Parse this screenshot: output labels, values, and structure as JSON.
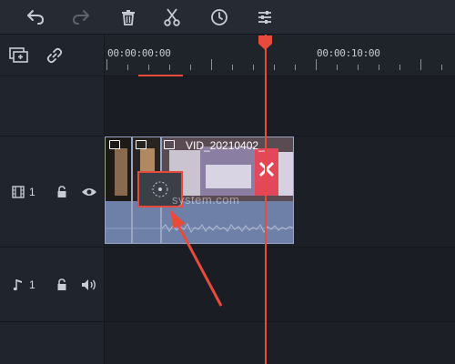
{
  "toolbar": {
    "icons": [
      "undo-icon",
      "redo-icon",
      "delete-icon",
      "cut-icon",
      "speed-clock-icon",
      "adjust-icon"
    ]
  },
  "left_panel": {
    "header_icons": [
      "add-track-icon",
      "link-icon"
    ],
    "video_track": {
      "number": "1",
      "icons": [
        "film-track-icon",
        "lock-icon",
        "eye-icon"
      ]
    },
    "audio_track": {
      "number": "1",
      "icons": [
        "music-note-icon",
        "lock-icon",
        "speaker-icon"
      ]
    }
  },
  "ruler": {
    "time_start": "00:00:00:00",
    "time_mid": "00:00:10:00"
  },
  "clip": {
    "name": "VID_20210402_"
  },
  "watermark": {
    "text": "system.com"
  },
  "colors": {
    "playhead": "#e84b3c",
    "selection": "#e84b3c",
    "clip": "#7382a8",
    "background": "#1c1f26"
  }
}
